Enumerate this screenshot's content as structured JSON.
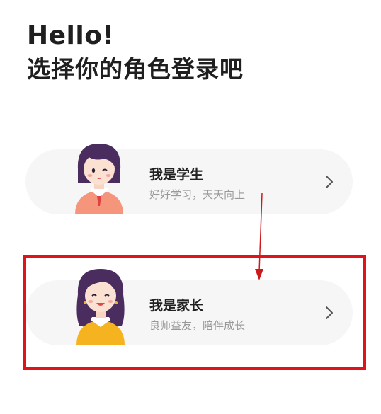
{
  "header": {
    "greeting": "Hello!",
    "subtitle": "选择你的角色登录吧"
  },
  "roles": [
    {
      "title": "我是学生",
      "description": "好好学习，天天向上",
      "avatar": "student-avatar",
      "chevron": "chevron-right-icon"
    },
    {
      "title": "我是家长",
      "description": "良师益友，陪伴成长",
      "avatar": "parent-avatar",
      "chevron": "chevron-right-icon"
    }
  ],
  "annotation": {
    "highlight_color": "#e0121a",
    "arrow_color": "#cc1a1a",
    "highlighted_role": "我是家长"
  },
  "colors": {
    "card_background": "#f6f6f7",
    "title_text": "#222222",
    "description_text": "#999999"
  }
}
